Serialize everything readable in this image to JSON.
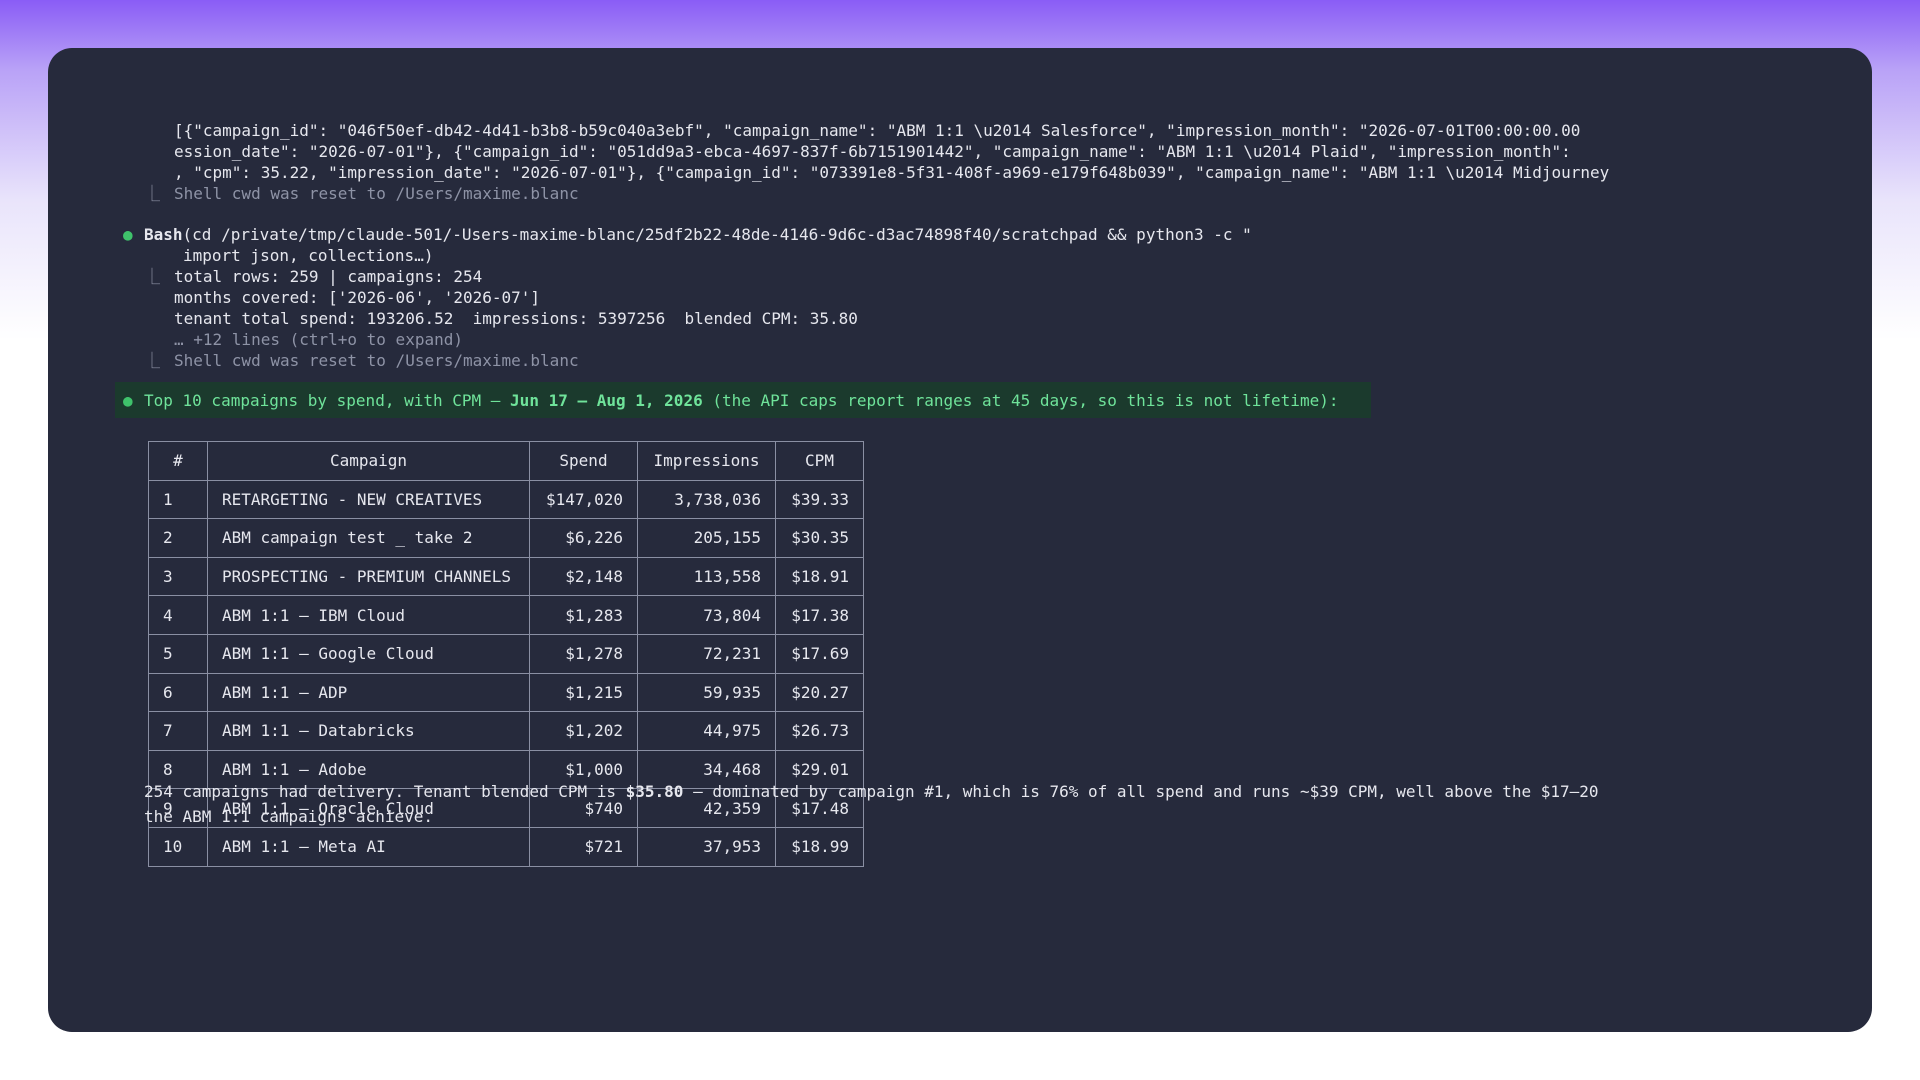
{
  "output_lines": [
    "[{\"campaign_id\": \"046f50ef-db42-4d41-b3b8-b59c040a3ebf\", \"campaign_name\": \"ABM 1:1 \\u2014 Salesforce\", \"impression_month\": \"2026-07-01T00:00:00.00",
    "ession_date\": \"2026-07-01\"}, {\"campaign_id\": \"051dd9a3-ebca-4697-837f-6b7151901442\", \"campaign_name\": \"ABM 1:1 \\u2014 Plaid\", \"impression_month\":",
    ", \"cpm\": 35.22, \"impression_date\": \"2026-07-01\"}, {\"campaign_id\": \"073391e8-5f31-408f-a969-e179f648b039\", \"campaign_name\": \"ABM 1:1 \\u2014 Midjourney"
  ],
  "cwd_reset_1": "Shell cwd was reset to /Users/maxime.blanc",
  "bash": {
    "label": "Bash",
    "command": "(cd /private/tmp/claude-501/-Users-maxime-blanc/25df2b22-48de-4146-9d6c-d3ac74898f40/scratchpad && python3 -c \"",
    "command_cont": "import json, collections…)"
  },
  "result_lines": [
    "total rows: 259 | campaigns: 254",
    "months covered: ['2026-06', '2026-07']",
    "tenant total spend: 193206.52  impressions: 5397256  blended CPM: 35.80"
  ],
  "expand_hint": "… +12 lines (ctrl+o to expand)",
  "cwd_reset_2": "Shell cwd was reset to /Users/maxime.blanc",
  "summary": {
    "prefix": "Top 10 campaigns by spend, with CPM — ",
    "range": "Jun 17 – Aug 1, 2026",
    "suffix": " (the API caps report ranges at 45 days, so this is not lifetime):"
  },
  "table": {
    "headers": [
      "#",
      "Campaign",
      "Spend",
      "Impressions",
      "CPM"
    ],
    "rows": [
      [
        "1",
        "RETARGETING - NEW CREATIVES",
        "$147,020",
        "3,738,036",
        "$39.33"
      ],
      [
        "2",
        "ABM campaign test _ take 2",
        "$6,226",
        "205,155",
        "$30.35"
      ],
      [
        "3",
        "PROSPECTING - PREMIUM CHANNELS",
        "$2,148",
        "113,558",
        "$18.91"
      ],
      [
        "4",
        "ABM 1:1 — IBM Cloud",
        "$1,283",
        "73,804",
        "$17.38"
      ],
      [
        "5",
        "ABM 1:1 — Google Cloud",
        "$1,278",
        "72,231",
        "$17.69"
      ],
      [
        "6",
        "ABM 1:1 — ADP",
        "$1,215",
        "59,935",
        "$20.27"
      ],
      [
        "7",
        "ABM 1:1 — Databricks",
        "$1,202",
        "44,975",
        "$26.73"
      ],
      [
        "8",
        "ABM 1:1 — Adobe",
        "$1,000",
        "34,468",
        "$29.01"
      ],
      [
        "9",
        "ABM 1:1 — Oracle Cloud",
        "$740",
        "42,359",
        "$17.48"
      ],
      [
        "10",
        "ABM 1:1 — Meta AI",
        "$721",
        "37,953",
        "$18.99"
      ]
    ]
  },
  "footer": {
    "a": "254 campaigns had delivery. Tenant blended CPM is ",
    "b": "$35.80",
    "c": " — dominated by campaign #1, which is 76% of all spend and runs ~$39 CPM, well above the $17–20",
    "d": "the ABM 1:1 campaigns achieve."
  },
  "glyphs": {
    "bullet": "●",
    "elbow": "⎿"
  },
  "colors": {
    "terminal_bg": "#262a3c",
    "bullet_green": "#3fc26b",
    "highlight_bg": "#1b3a2d",
    "highlight_text": "#6fe39a",
    "dim_text": "#8e93a6"
  }
}
